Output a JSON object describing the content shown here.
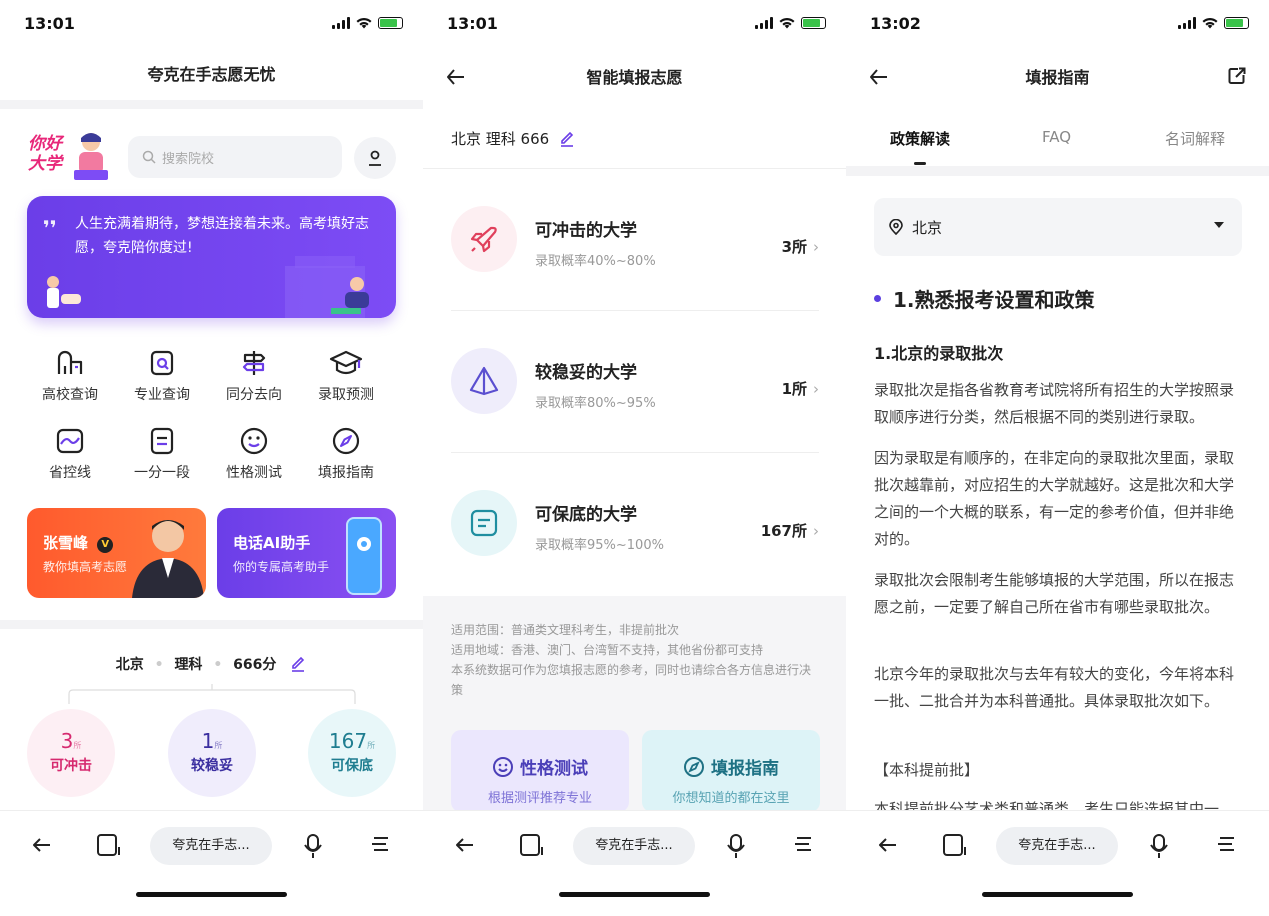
{
  "screen1": {
    "time": "13:01",
    "title": "夸克在手志愿无忧",
    "logo_text": "你好大学",
    "search_placeholder": "搜索院校",
    "banner_text": "人生充满着期待，梦想连接着未来。高考填好志愿，夸克陪你度过!",
    "grid_row1": [
      "高校查询",
      "专业查询",
      "同分去向",
      "录取预测"
    ],
    "grid_row2": [
      "省控线",
      "一分一段",
      "性格测试",
      "填报指南"
    ],
    "card_left": {
      "title": "张雪峰",
      "subtitle": "教你填高考志愿"
    },
    "card_right": {
      "title": "电话AI助手",
      "subtitle": "你的专属高考助手"
    },
    "profile": {
      "province": "北京",
      "subject": "理科",
      "score": "666分"
    },
    "circles": [
      {
        "num": "3",
        "unit": "所",
        "label": "可冲击"
      },
      {
        "num": "1",
        "unit": "所",
        "label": "较稳妥"
      },
      {
        "num": "167",
        "unit": "所",
        "label": "可保底"
      }
    ]
  },
  "screen2": {
    "time": "13:01",
    "title": "智能填报志愿",
    "subtitle": "北京 理科 666",
    "options": [
      {
        "title": "可冲击的大学",
        "prob": "录取概率40%~80%",
        "count": "3所"
      },
      {
        "title": "较稳妥的大学",
        "prob": "录取概率80%~95%",
        "count": "1所"
      },
      {
        "title": "可保底的大学",
        "prob": "录取概率95%~100%",
        "count": "167所"
      }
    ],
    "notes": [
      "适用范围：普通类文理科考生，非提前批次",
      "适用地域：香港、澳门、台湾暂不支持，其他省份都可支持",
      "本系统数据可作为您填报志愿的参考，同时也请综合各方信息进行决策"
    ],
    "btn_left": {
      "title": "性格测试",
      "subtitle": "根据测评推荐专业"
    },
    "btn_right": {
      "title": "填报指南",
      "subtitle": "你想知道的都在这里"
    }
  },
  "screen3": {
    "time": "13:02",
    "title": "填报指南",
    "tabs": [
      "政策解读",
      "FAQ",
      "名词解释"
    ],
    "location": "北京",
    "heading": "1.熟悉报考设置和政策",
    "subheading": "1.北京的录取批次",
    "paragraphs": [
      "录取批次是指各省教育考试院将所有招生的大学按照录取顺序进行分类，然后根据不同的类别进行录取。",
      "因为录取是有顺序的，在非定向的录取批次里面，录取批次越靠前，对应招生的大学就越好。这是批次和大学之间的一个大概的联系，有一定的参考价值，但并非绝对的。",
      "录取批次会限制考生能够填报的大学范围，所以在报志愿之前，一定要了解自己所在省市有哪些录取批次。",
      "北京今年的录取批次与去年有较大的变化，今年将本科一批、二批合并为本科普通批。具体录取批次如下。",
      "【本科提前批】",
      "本科提前批分艺术类和普通类，考生只能选报其中一"
    ]
  },
  "bottom_pill": "夸克在手志..."
}
